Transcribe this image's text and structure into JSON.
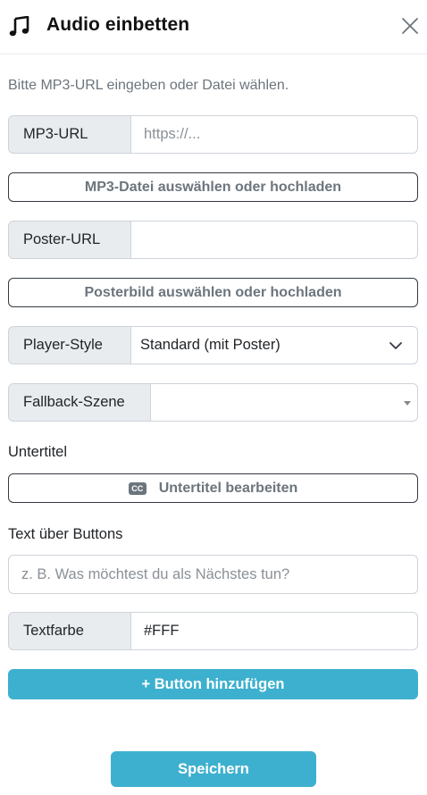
{
  "header": {
    "title": "Audio einbetten",
    "icon": "music-note-icon",
    "close_icon": "close-icon"
  },
  "hint": "Bitte MP3-URL eingeben oder Datei wählen.",
  "mp3_url": {
    "label": "MP3-URL",
    "placeholder": "https://..."
  },
  "mp3_file_button": "MP3-Datei auswählen oder hochladen",
  "poster_url": {
    "label": "Poster-URL",
    "value": ""
  },
  "poster_file_button": "Posterbild auswählen oder hochladen",
  "player_style": {
    "label": "Player-Style",
    "value": "Standard (mit Poster)"
  },
  "fallback_scene": {
    "label": "Fallback-Szene",
    "value": ""
  },
  "subtitles": {
    "label": "Untertitel",
    "button": "Untertitel bearbeiten",
    "icon": "closed-captions-icon",
    "icon_text": "CC"
  },
  "text_above_buttons": {
    "label": "Text über Buttons",
    "placeholder": "z. B. Was möchtest du als Nächstes tun?"
  },
  "text_color": {
    "label": "Textfarbe",
    "value": "#FFF"
  },
  "add_button": "+ Button hinzufügen",
  "save_button": "Speichern",
  "colors": {
    "accent": "#3eb0cf",
    "addon_bg": "#e9ecef",
    "border": "#ced4da",
    "muted_text": "#6c757d"
  }
}
